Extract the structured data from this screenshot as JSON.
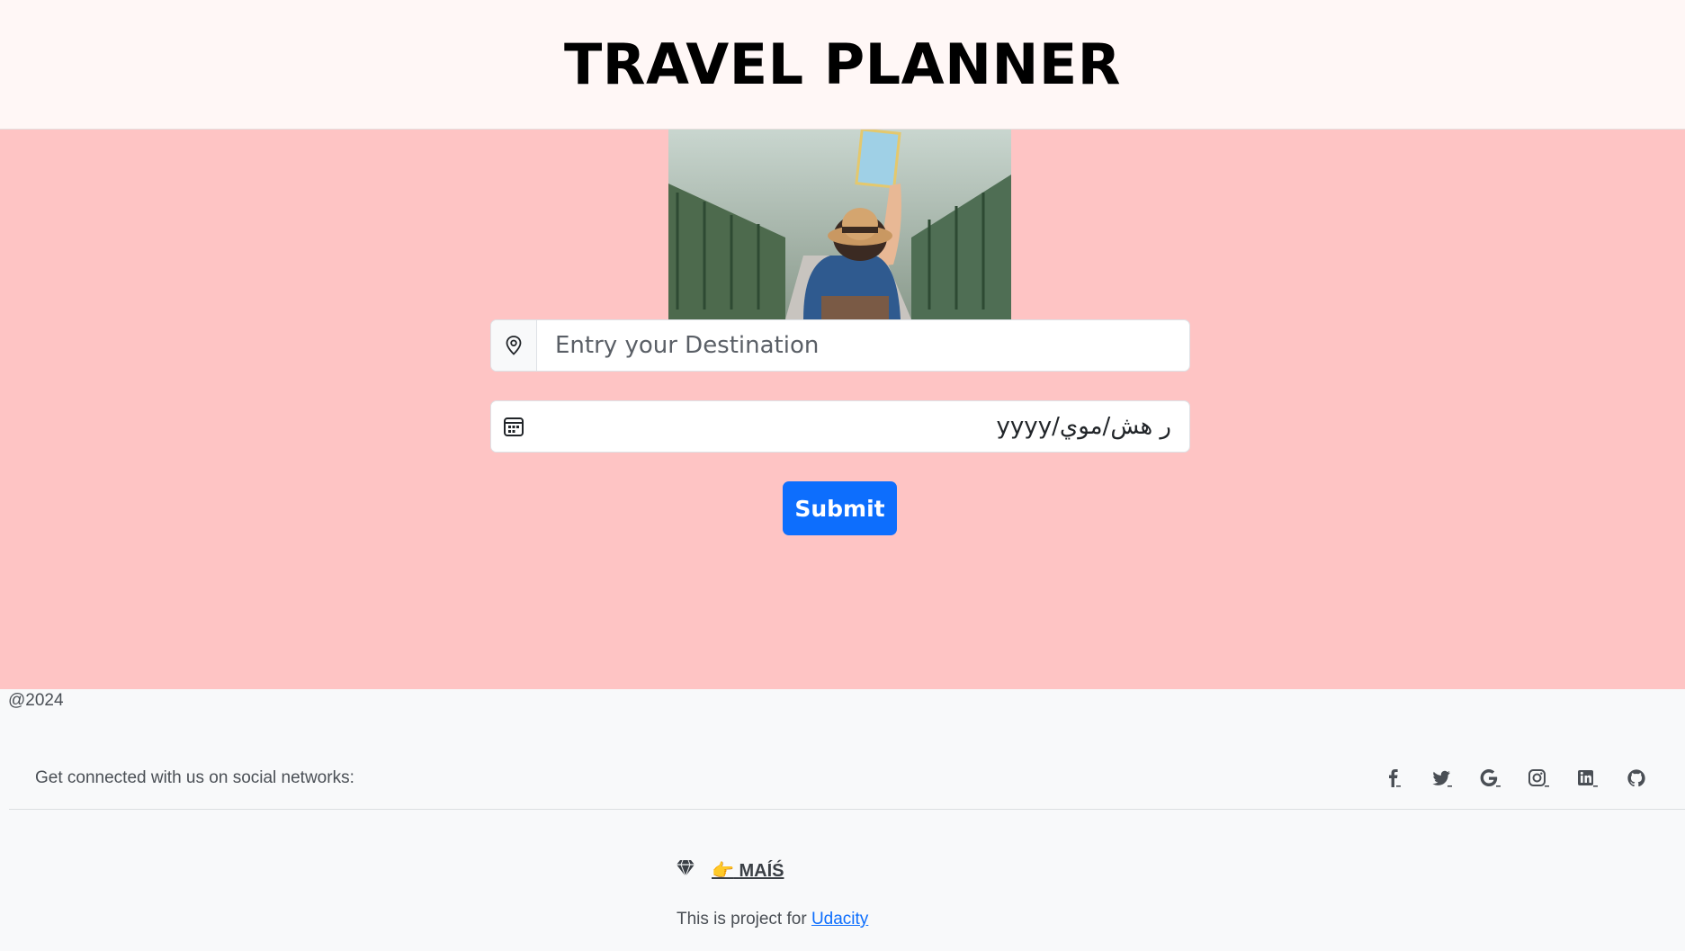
{
  "header": {
    "title": "TRAVEL PLANNER"
  },
  "hero": {
    "image": "traveler-with-map-photo"
  },
  "form": {
    "destination_placeholder": "Entry your Destination",
    "date_value": "yyyy/ر هش/موي",
    "submit_label": "Submit",
    "destination_icon": "map-pin-icon",
    "date_icon": "calendar-icon"
  },
  "footer": {
    "copyright": "@2024",
    "social_text": "Get connected with us on social networks:",
    "social_icons": [
      "facebook-icon",
      "twitter-icon",
      "google-icon",
      "instagram-icon",
      "linkedin-icon",
      "github-icon"
    ],
    "brand_emoji": "👉",
    "brand": "MAÍŚ",
    "project_prefix": "This is project for ",
    "project_link": "Udacity"
  },
  "colors": {
    "header_bg": "#fff7f6",
    "band_bg": "#fec4c4",
    "accent": "#0d6efd",
    "footer_bg": "#f8f9fa"
  }
}
